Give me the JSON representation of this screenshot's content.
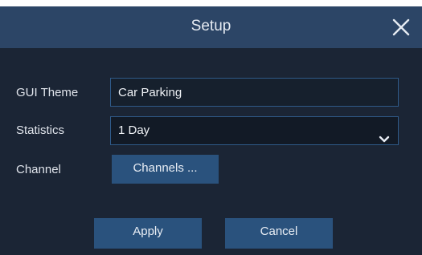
{
  "dialog": {
    "title": "Setup",
    "close_icon": "close-icon"
  },
  "form": {
    "gui_theme": {
      "label": "GUI Theme",
      "value": "Car Parking"
    },
    "statistics": {
      "label": "Statistics",
      "selected": "1 Day",
      "icon": "chevron-down-icon"
    },
    "channel": {
      "label": "Channel",
      "button_label": "Channels ..."
    }
  },
  "footer": {
    "apply_label": "Apply",
    "cancel_label": "Cancel"
  },
  "colors": {
    "background": "#1b2535",
    "titlebar": "#2c4566",
    "button": "#2a527d",
    "field_border": "#2f5a88"
  }
}
